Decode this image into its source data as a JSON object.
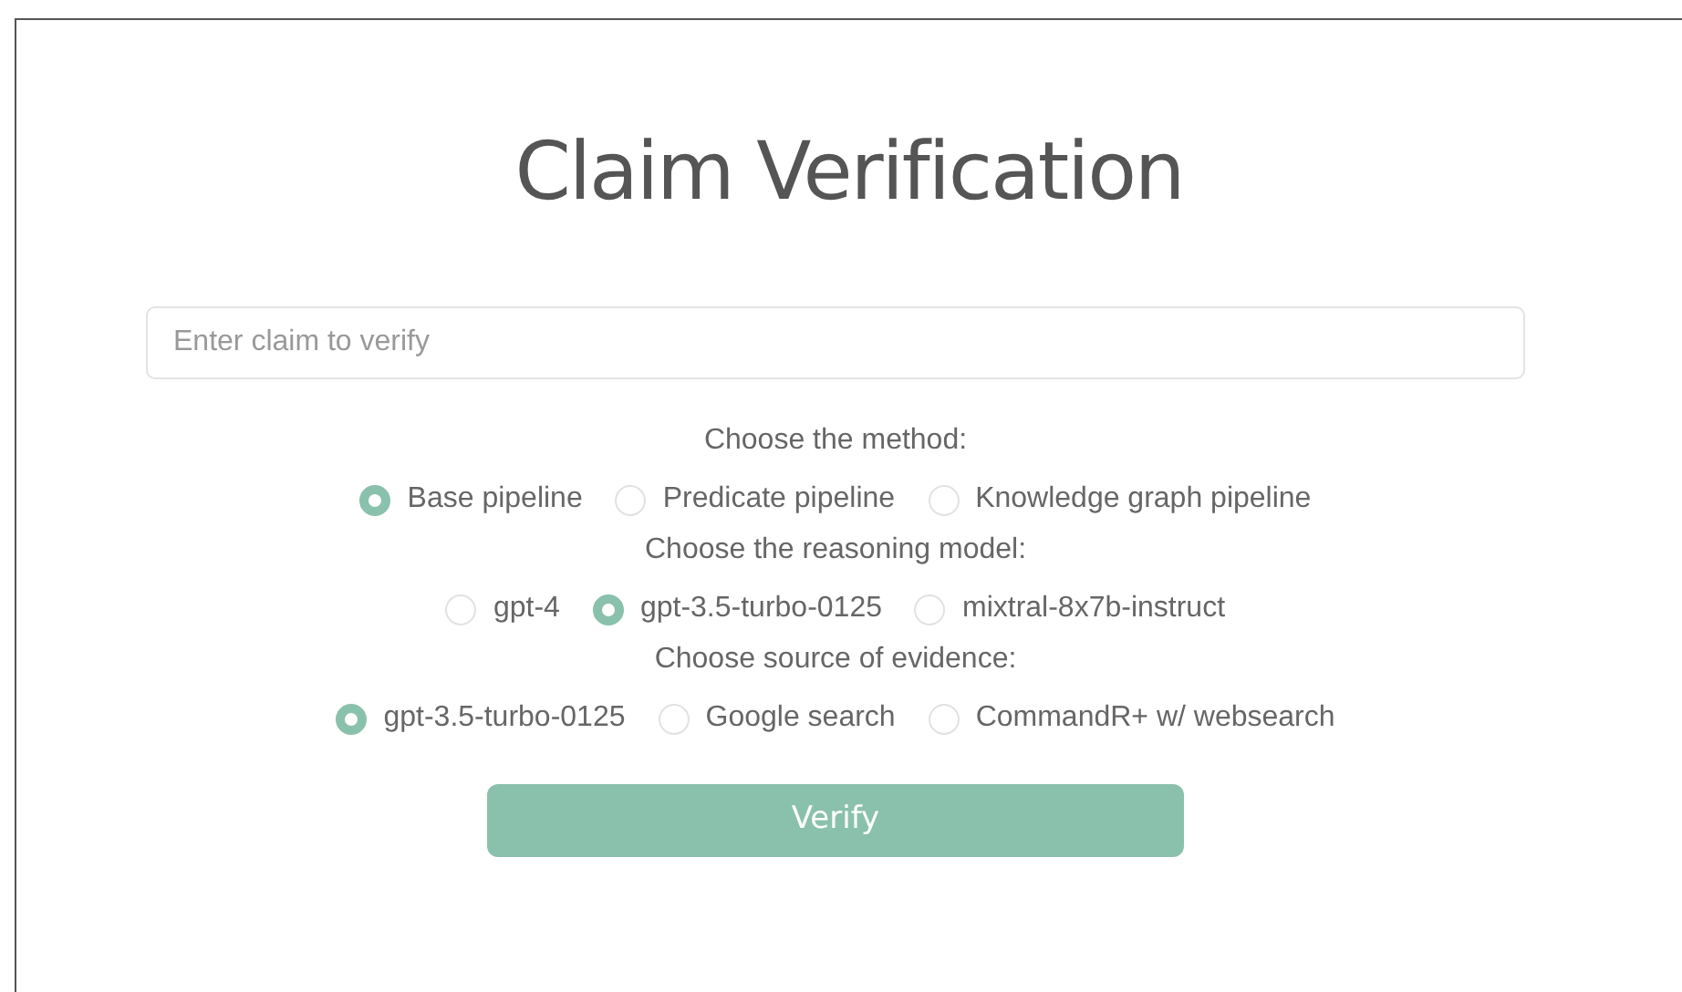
{
  "title": "Claim Verification",
  "claim_field": {
    "placeholder": "Enter claim to verify"
  },
  "groups": [
    {
      "label": "Choose the method:",
      "options": [
        {
          "label": "Base pipeline",
          "selected": true
        },
        {
          "label": "Predicate pipeline",
          "selected": false
        },
        {
          "label": "Knowledge graph pipeline",
          "selected": false
        }
      ]
    },
    {
      "label": "Choose the reasoning model:",
      "options": [
        {
          "label": "gpt-4",
          "selected": false
        },
        {
          "label": "gpt-3.5-turbo-0125",
          "selected": true
        },
        {
          "label": "mixtral-8x7b-instruct",
          "selected": false
        }
      ]
    },
    {
      "label": "Choose source of evidence:",
      "options": [
        {
          "label": "gpt-3.5-turbo-0125",
          "selected": true
        },
        {
          "label": "Google search",
          "selected": false
        },
        {
          "label": "CommandR+ w/ websearch",
          "selected": false
        }
      ]
    }
  ],
  "verify_button": "Verify"
}
